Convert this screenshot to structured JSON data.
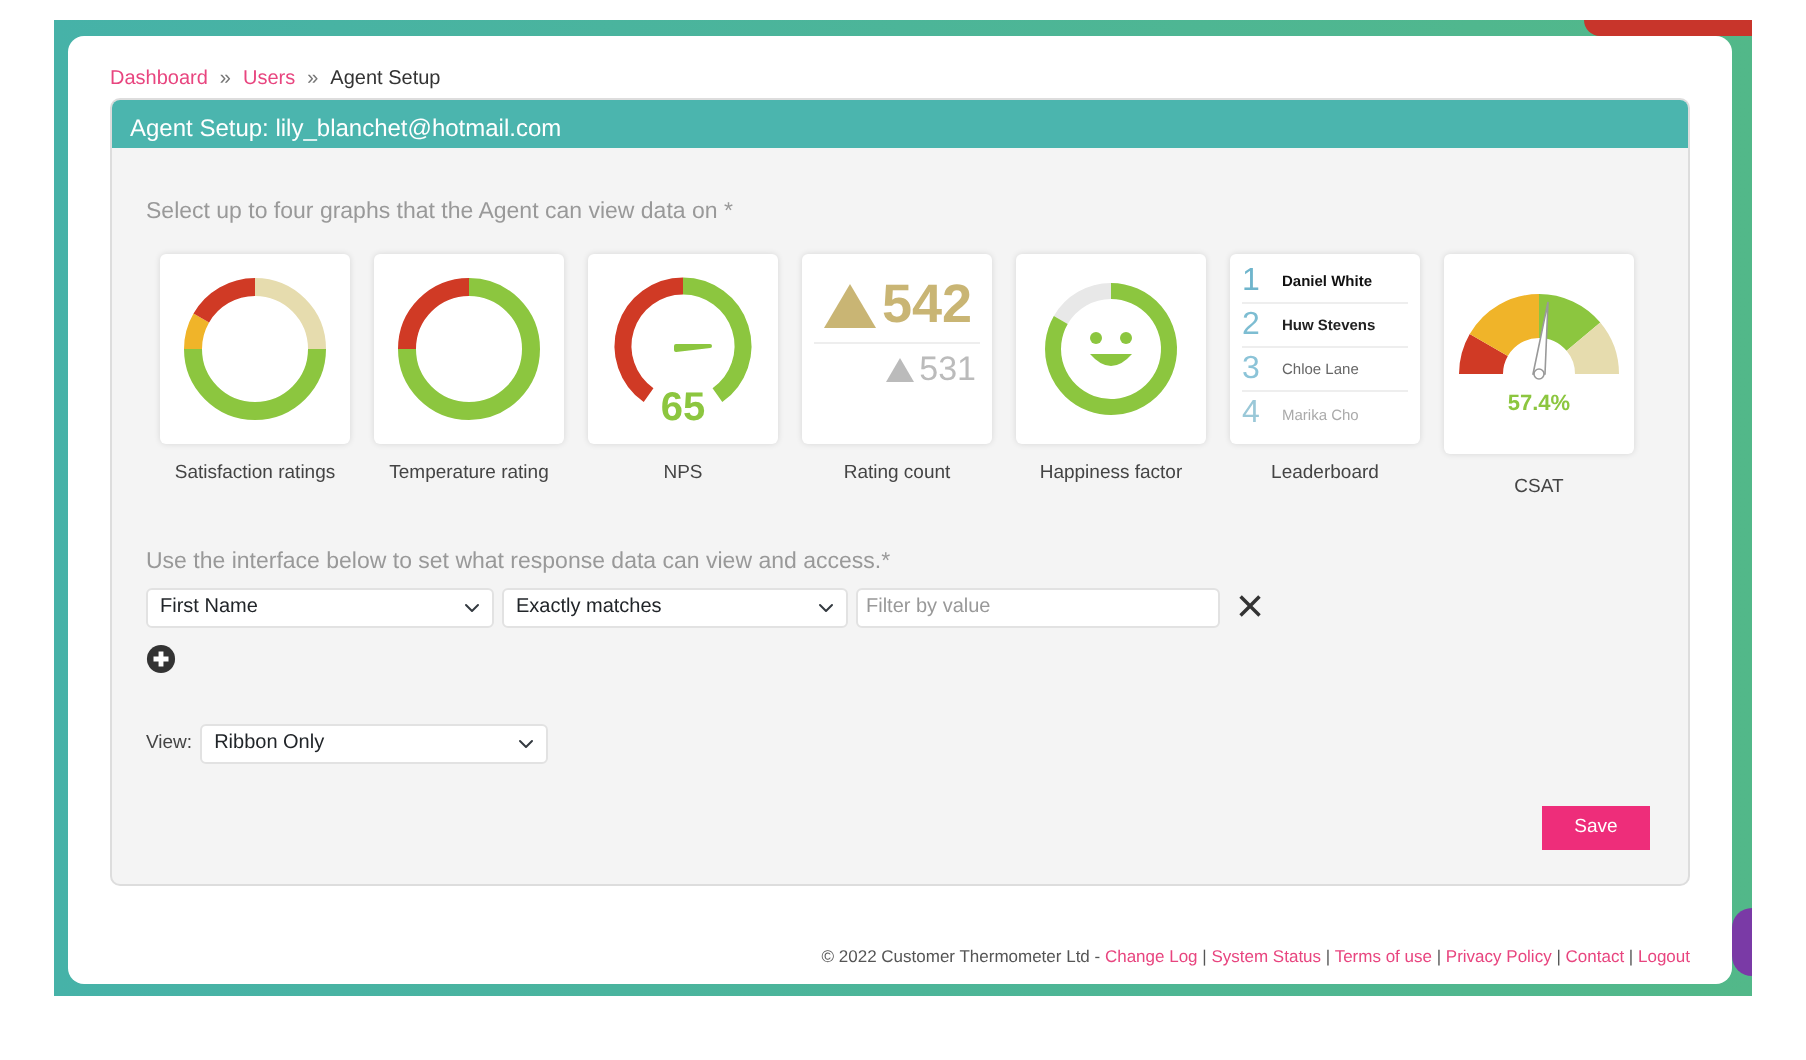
{
  "breadcrumb": [
    {
      "label": "Dashboard",
      "kind": "link"
    },
    {
      "label": "Users",
      "kind": "link"
    },
    {
      "label": "Agent Setup",
      "kind": "current"
    }
  ],
  "breadcrumb_separator": "»",
  "panel": {
    "title": "Agent Setup: lily_blanchet@hotmail.com"
  },
  "graphs_prompt": "Select up to four graphs that the Agent can view data on *",
  "graphs": [
    {
      "label": "Satisfaction ratings",
      "kind": "satisfaction"
    },
    {
      "label": "Temperature rating",
      "kind": "temperature"
    },
    {
      "label": "NPS",
      "kind": "nps",
      "value": "65"
    },
    {
      "label": "Rating count",
      "kind": "count",
      "value": "542",
      "previous": "531"
    },
    {
      "label": "Happiness factor",
      "kind": "happiness"
    },
    {
      "label": "Leaderboard",
      "kind": "leaderboard",
      "entries": [
        {
          "rank": "1",
          "name": "Daniel White"
        },
        {
          "rank": "2",
          "name": "Huw Stevens"
        },
        {
          "rank": "3",
          "name": "Chloe Lane"
        },
        {
          "rank": "4",
          "name": "Marika Cho"
        }
      ]
    },
    {
      "label": "CSAT",
      "kind": "csat",
      "value": "57.4%"
    }
  ],
  "filter_prompt": "Use the interface below to set what response data can view and access.*",
  "filter": {
    "field": "First Name",
    "operator": "Exactly matches",
    "placeholder": "Filter by value",
    "remove": "×"
  },
  "view": {
    "label": "View:",
    "value": "Ribbon Only"
  },
  "save_button": "Save",
  "footer": {
    "copyright": "© 2022 Customer Thermometer Ltd -",
    "links": [
      "Change Log",
      "System Status",
      "Terms of use",
      "Privacy Policy",
      "Contact",
      "Logout"
    ],
    "separator": "|"
  }
}
